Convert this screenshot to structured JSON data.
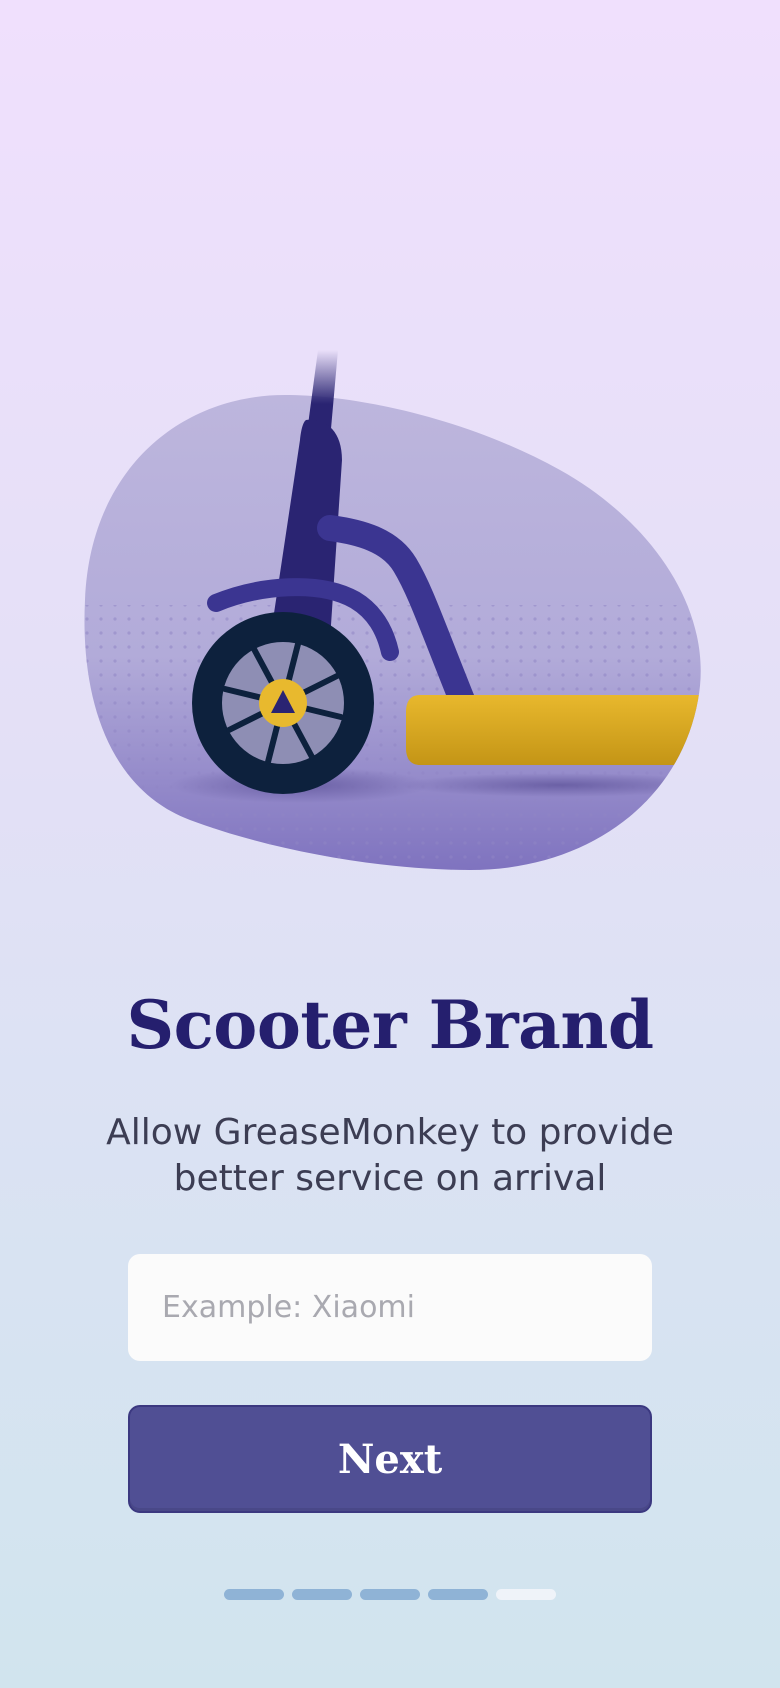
{
  "illustration": {
    "icon": "scooter-wheel-illustration",
    "colors": {
      "blob": "#b9b3dc",
      "stem": "#2a2472",
      "fork": "#3b3591",
      "wheel": "#0d213d",
      "hub": "#e8b92e",
      "deck": "#e2b22a"
    }
  },
  "title": "Scooter Brand",
  "subtitle": "Allow GreaseMonkey to provide\nbetter service on arrival",
  "brand_input": {
    "value": "",
    "placeholder": "Example: Xiaomi"
  },
  "next_button": {
    "label": "Next"
  },
  "progress": {
    "total_steps": 5,
    "current_step": 4
  },
  "colors": {
    "accent": "#504f94",
    "title": "#251f6e",
    "progress_active": "#8fb3d6",
    "progress_inactive": "#eff3f9"
  }
}
